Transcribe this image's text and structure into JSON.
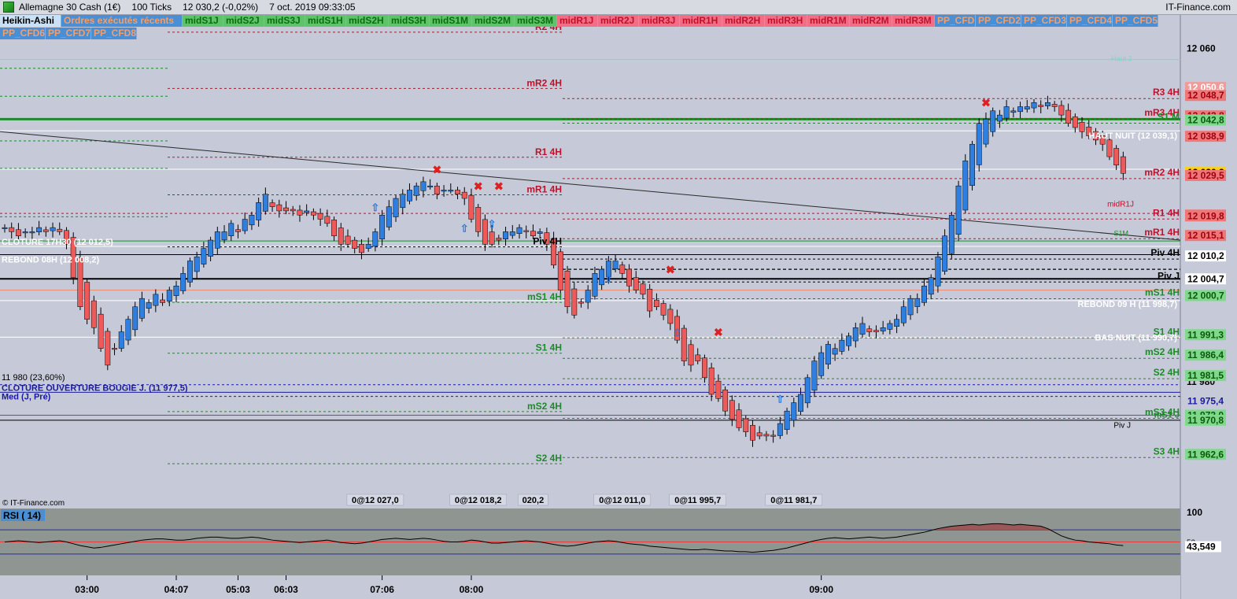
{
  "window": {
    "instrument": "Allemagne 30 Cash (1€)",
    "interval": "100 Ticks",
    "last_quote": "12 030,2 (-0,02%)",
    "datetime": "7 oct. 2019 09:33:05",
    "brand": "IT-Finance.com"
  },
  "toolbar": {
    "row1": [
      {
        "label": "Heikin-Ashi",
        "color": "#000000",
        "bg": "#c9e1f7"
      },
      {
        "label": "Ordres exécutés récents",
        "color": "#f0a070",
        "bg": "#4a8fd4"
      },
      {
        "label": "midS1J",
        "color": "#0a6e0a",
        "bg": "#5fc36b"
      },
      {
        "label": "midS2J",
        "color": "#0a6e0a",
        "bg": "#5fc36b"
      },
      {
        "label": "midS3J",
        "color": "#0a6e0a",
        "bg": "#5fc36b"
      },
      {
        "label": "midS1H",
        "color": "#0a6e0a",
        "bg": "#5fc36b"
      },
      {
        "label": "midS2H",
        "color": "#0a6e0a",
        "bg": "#5fc36b"
      },
      {
        "label": "midS3H",
        "color": "#0a6e0a",
        "bg": "#5fc36b"
      },
      {
        "label": "midS1M",
        "color": "#0a6e0a",
        "bg": "#5fc36b"
      },
      {
        "label": "midS2M",
        "color": "#0a6e0a",
        "bg": "#5fc36b"
      },
      {
        "label": "midS3M",
        "color": "#0a6e0a",
        "bg": "#5fc36b"
      },
      {
        "label": "midR1J",
        "color": "#c0102a",
        "bg": "#f06f86"
      },
      {
        "label": "midR2J",
        "color": "#c0102a",
        "bg": "#f06f86"
      },
      {
        "label": "midR3J",
        "color": "#c0102a",
        "bg": "#f06f86"
      },
      {
        "label": "midR1H",
        "color": "#c0102a",
        "bg": "#f06f86"
      },
      {
        "label": "midR2H",
        "color": "#c0102a",
        "bg": "#f06f86"
      },
      {
        "label": "midR3H",
        "color": "#c0102a",
        "bg": "#f06f86"
      },
      {
        "label": "midR1M",
        "color": "#c0102a",
        "bg": "#f06f86"
      },
      {
        "label": "midR2M",
        "color": "#c0102a",
        "bg": "#f06f86"
      },
      {
        "label": "midR3M",
        "color": "#c0102a",
        "bg": "#f06f86"
      },
      {
        "label": "PP_CFD",
        "color": "#f0a070",
        "bg": "#4a8fd4"
      },
      {
        "label": "PP_CFD2",
        "color": "#f0a070",
        "bg": "#4a8fd4"
      },
      {
        "label": "PP_CFD3",
        "color": "#f0a070",
        "bg": "#4a8fd4"
      },
      {
        "label": "PP_CFD4",
        "color": "#f0a070",
        "bg": "#4a8fd4"
      },
      {
        "label": "PP_CFD5",
        "color": "#f0a070",
        "bg": "#4a8fd4"
      }
    ],
    "row2": [
      {
        "label": "PP_CFD6",
        "color": "#f0a070",
        "bg": "#4a8fd4"
      },
      {
        "label": "PP_CFD7",
        "color": "#f0a070",
        "bg": "#4a8fd4"
      },
      {
        "label": "PP_CFD8",
        "color": "#f0a070",
        "bg": "#4a8fd4"
      }
    ]
  },
  "chart_data": {
    "type": "candlestick",
    "ylim": [
      11950,
      12068
    ],
    "y_ticks": [
      "12 060",
      "11 980"
    ],
    "y_tick_values": [
      12060,
      11980
    ],
    "x_ticks": [
      "03:00",
      "04:07",
      "05:03",
      "06:03",
      "07:06",
      "08:00",
      "09:00"
    ],
    "x_tick_candle_index": [
      12,
      25,
      34,
      41,
      55,
      68,
      119
    ],
    "colors": {
      "up": "#2f7fe0",
      "down": "#ee5a5a",
      "support": "#1d8a2a",
      "resistance": "#c0102a",
      "neutral": "#000000",
      "blue_level": "#1a1aa0"
    },
    "candles_close": [
      12017,
      12016,
      12015,
      12016,
      12016,
      12017,
      12016,
      12017,
      12016,
      12013,
      12005,
      11998,
      11995,
      11993,
      11988,
      11984,
      11988,
      11992,
      11995,
      11998,
      12000,
      11999,
      12001,
      11999,
      12002,
      12003,
      12006,
      12009,
      12010,
      12012,
      12014,
      12016,
      12016,
      12018,
      12016,
      12019,
      12020,
      12023,
      12025,
      12022,
      12021,
      12021,
      12021,
      12020,
      12021,
      12020,
      12019,
      12018,
      12015,
      12013,
      12013,
      12012,
      12011,
      12013,
      12016,
      12020,
      12022,
      12024,
      12025,
      12026,
      12027,
      12028,
      12027,
      12025,
      12026,
      12026,
      12025,
      12024,
      12019,
      12016,
      12013,
      12013,
      12014,
      12016,
      12016,
      12017,
      12016,
      12015,
      12016,
      12013,
      12008,
      12002,
      11998,
      11996,
      11999,
      12002,
      12006,
      12007,
      12009,
      12009,
      12006,
      12003,
      12002,
      12001,
      11997,
      11998,
      11996,
      11994,
      11990,
      11985,
      11984,
      11985,
      11981,
      11977,
      11976,
      11973,
      11971,
      11969,
      11968,
      11966,
      11967,
      11967,
      11967,
      11970,
      11973,
      11975,
      11977,
      11981,
      11985,
      11987,
      11989,
      11988,
      11990,
      11991,
      11993,
      11994,
      11992,
      11992,
      11993,
      11994,
      11995,
      11998,
      12000,
      12000,
      12003,
      12005,
      12010,
      12015,
      12020,
      12027,
      12033,
      12037,
      12042,
      12043,
      12045,
      12044,
      12046,
      12045,
      12046,
      12046,
      12047,
      12046,
      12047,
      12046,
      12044,
      12042,
      12041,
      12040,
      12039,
      12038,
      12037,
      12034,
      12032,
      12030
    ],
    "levels": [
      {
        "label": "R2 4H",
        "value": 12065,
        "style": "resistance"
      },
      {
        "label": "mR2 4H",
        "value": 12051.5,
        "style": "resistance"
      },
      {
        "label": "R1 4H",
        "value": 12035,
        "style": "resistance"
      },
      {
        "label": "mR1 4H",
        "value": 12026,
        "style": "resistance"
      },
      {
        "label": "Piv 4H",
        "value": 12013.5,
        "style": "neutral"
      },
      {
        "label": "mS1 4H",
        "value": 12000.2,
        "style": "support"
      },
      {
        "label": "S1 4H",
        "value": 11988,
        "style": "support"
      },
      {
        "label": "mS2 4H",
        "value": 11974,
        "style": "support"
      },
      {
        "label": "S2 4H",
        "value": 11961.5,
        "style": "support"
      }
    ],
    "right_levels": [
      {
        "label": "R3 4H",
        "value": 12048.7,
        "style": "resistance"
      },
      {
        "label": "mR3 4H",
        "value": 12043.8,
        "style": "resistance"
      },
      {
        "label": "S1 M",
        "value": 12042.8,
        "style": "support"
      },
      {
        "label": "mR2 4H",
        "value": 12029.5,
        "style": "resistance"
      },
      {
        "label": "R1 4H",
        "value": 12019.8,
        "style": "resistance"
      },
      {
        "label": "mR1 4H",
        "value": 12015.1,
        "style": "resistance"
      },
      {
        "label": "Piv 4H",
        "value": 12010.2,
        "style": "neutral"
      },
      {
        "label": "Piv J",
        "value": 12004.7,
        "style": "neutral"
      },
      {
        "label": "mS1 4H",
        "value": 12000.7,
        "style": "support"
      },
      {
        "label": "S1 4H",
        "value": 11991.3,
        "style": "support"
      },
      {
        "label": "mS2 4H",
        "value": 11986.4,
        "style": "support"
      },
      {
        "label": "S2 4H",
        "value": 11981.5,
        "style": "support"
      },
      {
        "label": "mS3 4H",
        "value": 11972.0,
        "style": "support"
      },
      {
        "label": "S3 4H",
        "value": 11962.6,
        "style": "support"
      }
    ],
    "right_labels": {
      "haut_j": "Haut J",
      "midR1J": "midR1J",
      "s1m_small": "S1M",
      "piv_j_small": "Piv J",
      "ms1_j": "mS1 J"
    },
    "text_labels": {
      "cloture_17h30": "CLOTURE 17H30 (12 012,5)",
      "rebond_08h": "REBOND 08H (12 008,2)",
      "haut_nuit": "HAUT NUIT (12 039,1)",
      "rebond_09h": "REBOND 09 H (11 998,7)",
      "bas_nuit": "BAS NUIT (11 990,7)",
      "fib_11980": "11 980 (23,60%)",
      "cloture_ouverture": "CLOTURE OUVERTURE BOUGIE J. (11 977,5)",
      "med": "Med (J, Pré)"
    },
    "price_boxes": [
      {
        "text": "12 050,6",
        "value": 12050.6,
        "bg": "#f09a9a",
        "fg": "#ffffff"
      },
      {
        "text": "12 048,7",
        "value": 12048.7,
        "bg": "#ee7878",
        "fg": "#a00010"
      },
      {
        "text": "12 043,8",
        "value": 12043.8,
        "bg": "#ee7878",
        "fg": "#a00010"
      },
      {
        "text": "12 042,8",
        "value": 12042.8,
        "bg": "#7fd88b",
        "fg": "#0a5a0a"
      },
      {
        "text": "12 038,9",
        "value": 12038.9,
        "bg": "#ee7878",
        "fg": "#a00010"
      },
      {
        "text": "12 030,3",
        "value": 12030.3,
        "bg": "#c6cad8",
        "fg": "#000000"
      },
      {
        "text": "12 030,2",
        "value": 12030.2,
        "bg": "#ffd400",
        "fg": "#000000"
      },
      {
        "text": "12 029,5",
        "value": 12029.5,
        "bg": "#ee7878",
        "fg": "#a00010"
      },
      {
        "text": "12 020,0",
        "value": 12020.0,
        "bg": "#ee7878",
        "fg": "#a00010"
      },
      {
        "text": "12 019,8",
        "value": 12019.8,
        "bg": "#ee7878",
        "fg": "#a00010"
      },
      {
        "text": "12 015,1",
        "value": 12015.1,
        "bg": "#ee7878",
        "fg": "#a00010"
      },
      {
        "text": "12 010,2",
        "value": 12010.2,
        "bg": "#ffffff",
        "fg": "#000000"
      },
      {
        "text": "12 004,7",
        "value": 12004.7,
        "bg": "#ffffff",
        "fg": "#000000"
      },
      {
        "text": "12 000,7",
        "value": 12000.7,
        "bg": "#7fd88b",
        "fg": "#0a5a0a"
      },
      {
        "text": "11 991,3",
        "value": 11991.3,
        "bg": "#7fd88b",
        "fg": "#0a5a0a"
      },
      {
        "text": "11 986,4",
        "value": 11986.4,
        "bg": "#7fd88b",
        "fg": "#0a5a0a"
      },
      {
        "text": "11 981,5",
        "value": 11981.5,
        "bg": "#7fd88b",
        "fg": "#0a5a0a"
      },
      {
        "text": "11 975,4",
        "value": 11975.4,
        "bg": "#c6cad8",
        "fg": "#1a1aa0"
      },
      {
        "text": "11 972,0",
        "value": 11972.0,
        "bg": "#7fd88b",
        "fg": "#0a5a0a"
      },
      {
        "text": "11 970,8",
        "value": 11970.8,
        "bg": "#7fd88b",
        "fg": "#0a5a0a"
      },
      {
        "text": "11 962,6",
        "value": 11962.6,
        "bg": "#7fd88b",
        "fg": "#0a5a0a"
      }
    ],
    "order_labels": [
      "0@12 027,0",
      "0@12 018,2",
      "020,2",
      "0@12 011,0",
      "0@11 995,7",
      "0@11 981,7"
    ],
    "order_label_candle_index": [
      54,
      69,
      77,
      90,
      101,
      115
    ],
    "copyright": "© IT-Finance.com"
  },
  "rsi": {
    "label": "RSI ( 14)",
    "value": "43,549",
    "upper_tick": "100",
    "mid_tick": "50",
    "values": [
      50,
      51,
      52,
      51,
      50,
      49,
      50,
      51,
      52,
      50,
      47,
      44,
      42,
      40,
      41,
      43,
      45,
      47,
      49,
      51,
      53,
      54,
      55,
      55,
      54,
      53,
      53,
      54,
      56,
      57,
      58,
      58,
      57,
      56,
      56,
      57,
      58,
      57,
      55,
      53,
      52,
      51,
      50,
      49,
      50,
      51,
      52,
      53,
      51,
      49,
      48,
      47,
      48,
      50,
      52,
      54,
      55,
      56,
      55,
      54,
      55,
      56,
      55,
      53,
      51,
      50,
      50,
      51,
      53,
      52,
      50,
      48,
      48,
      49,
      50,
      51,
      52,
      51,
      50,
      48,
      46,
      44,
      43,
      44,
      46,
      48,
      50,
      51,
      52,
      51,
      49,
      47,
      46,
      45,
      43,
      42,
      41,
      40,
      39,
      38,
      37,
      37,
      38,
      37,
      36,
      35,
      35,
      34,
      34,
      33,
      34,
      35,
      36,
      38,
      40,
      43,
      46,
      49,
      52,
      54,
      56,
      57,
      56,
      55,
      56,
      57,
      58,
      57,
      56,
      57,
      58,
      60,
      62,
      64,
      66,
      69,
      72,
      74,
      76,
      77,
      78,
      79,
      78,
      79,
      80,
      80,
      79,
      78,
      79,
      78,
      77,
      76,
      72,
      66,
      60,
      56,
      53,
      52,
      50,
      49,
      48,
      47,
      45,
      44
    ]
  }
}
